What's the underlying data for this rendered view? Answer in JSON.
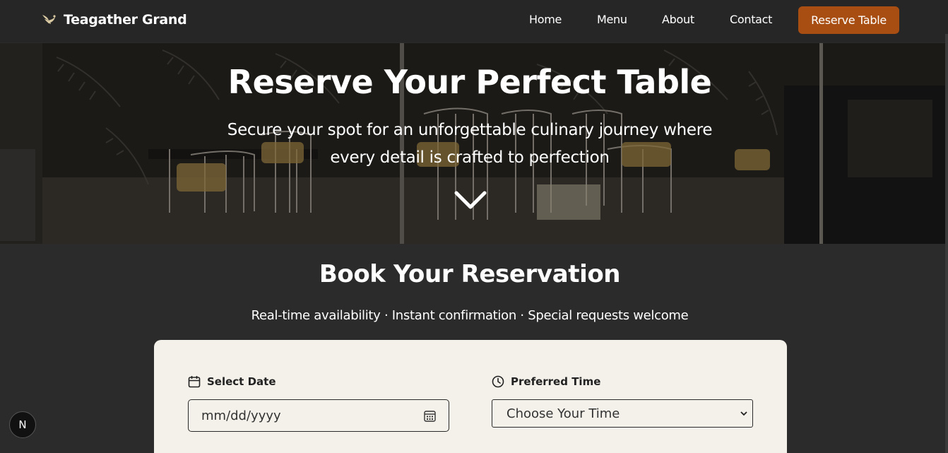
{
  "brand": {
    "name": "Teagather Grand",
    "icon": "bird-logo-icon"
  },
  "nav": {
    "links": [
      "Home",
      "Menu",
      "About",
      "Contact"
    ],
    "cta": "Reserve Table"
  },
  "hero": {
    "title": "Reserve Your Perfect Table",
    "subtitle": "Secure your spot for an unforgettable culinary journey where every detail is crafted to perfection",
    "scroll_icon": "chevron-down-icon"
  },
  "reservation": {
    "title": "Book Your Reservation",
    "subtitle": "Real-time availability · Instant confirmation · Special requests welcome",
    "date": {
      "label": "Select Date",
      "placeholder": "mm/dd/yyyy",
      "icon": "calendar-icon"
    },
    "time": {
      "label": "Preferred Time",
      "value": "Choose Your Time",
      "icon": "clock-icon"
    }
  },
  "dev_badge": "N",
  "colors": {
    "accent": "#a84e12",
    "card": "#f4f1ea",
    "background": "#2b2b2b",
    "navbar": "#262626"
  }
}
